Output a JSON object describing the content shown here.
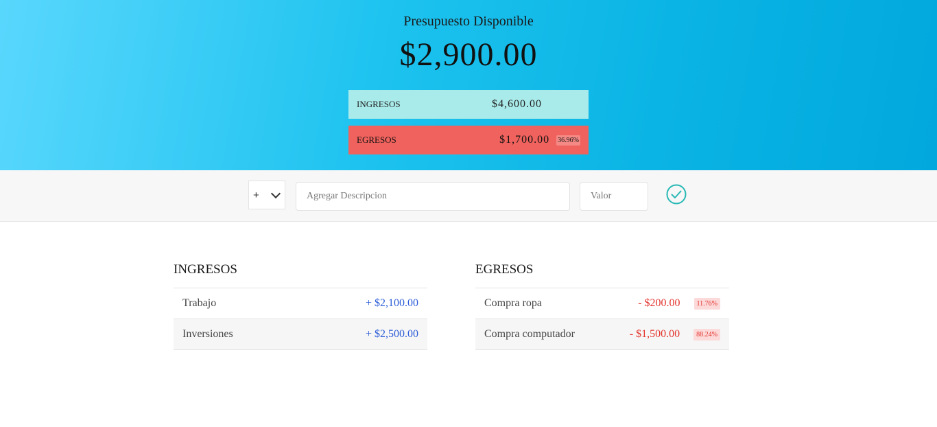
{
  "header": {
    "title": "Presupuesto Disponible",
    "available": "$2,900.00",
    "income": {
      "label": "INGRESOS",
      "value": "$4,600.00"
    },
    "expense": {
      "label": "EGRESOS",
      "value": "$1,700.00",
      "percentage": "36.96%"
    }
  },
  "form": {
    "type_selected": "+",
    "description_placeholder": "Agregar Descripcion",
    "value_placeholder": "Valor",
    "submit_icon": "check-circle-icon"
  },
  "income_list": {
    "title": "INGRESOS",
    "items": [
      {
        "description": "Trabajo",
        "value": "+ $2,100.00"
      },
      {
        "description": "Inversiones",
        "value": "+ $2,500.00"
      }
    ]
  },
  "expense_list": {
    "title": "EGRESOS",
    "items": [
      {
        "description": "Compra ropa",
        "value": "- $200.00",
        "percentage": "11.76%"
      },
      {
        "description": "Compra computador",
        "value": "- $1,500.00",
        "percentage": "88.24%"
      }
    ]
  },
  "colors": {
    "income_bg": "#a9ebea",
    "expense_bg": "#f0625d",
    "income_text": "#2a5bd7",
    "expense_text": "#e3332c",
    "accent": "#28b9b5"
  }
}
